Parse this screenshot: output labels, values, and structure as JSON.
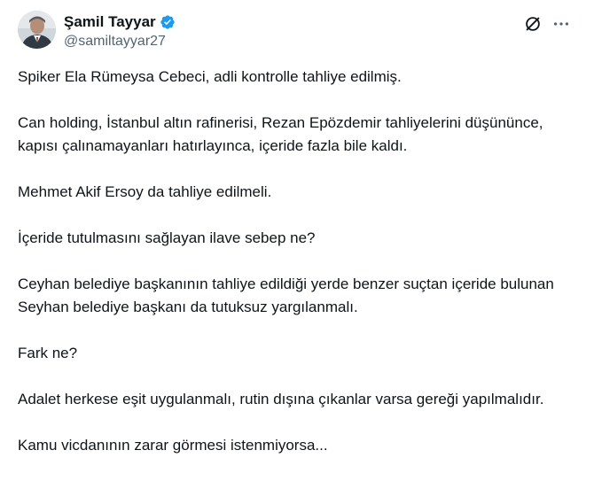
{
  "author": {
    "display_name": "Şamil Tayyar",
    "handle": "@samiltayyar27",
    "verified_color": "#1d9bf0"
  },
  "icons": {
    "verified": "verified-badge-icon",
    "grok": "grok-icon",
    "more": "more-options-icon"
  },
  "tweet": {
    "paragraphs": [
      "Spiker Ela Rümeysa Cebeci, adli kontrolle tahliye edilmiş.",
      "Can holding, İstanbul altın rafinerisi, Rezan Epözdemir tahliyelerini düşününce, kapısı çalınamayanları hatırlayınca, içeride fazla bile kaldı.",
      "Mehmet Akif Ersoy da tahliye edilmeli.",
      "İçeride tutulmasını sağlayan ilave sebep ne?",
      "Ceyhan belediye başkanının tahliye edildiği yerde benzer suçtan içeride bulunan Seyhan belediye başkanı da tutuksuz yargılanmalı.",
      "Fark ne?",
      "Adalet herkese eşit uygulanmalı, rutin dışına çıkanlar varsa gereği yapılmalıdır.",
      "Kamu vicdanının zarar görmesi istenmiyorsa..."
    ]
  }
}
